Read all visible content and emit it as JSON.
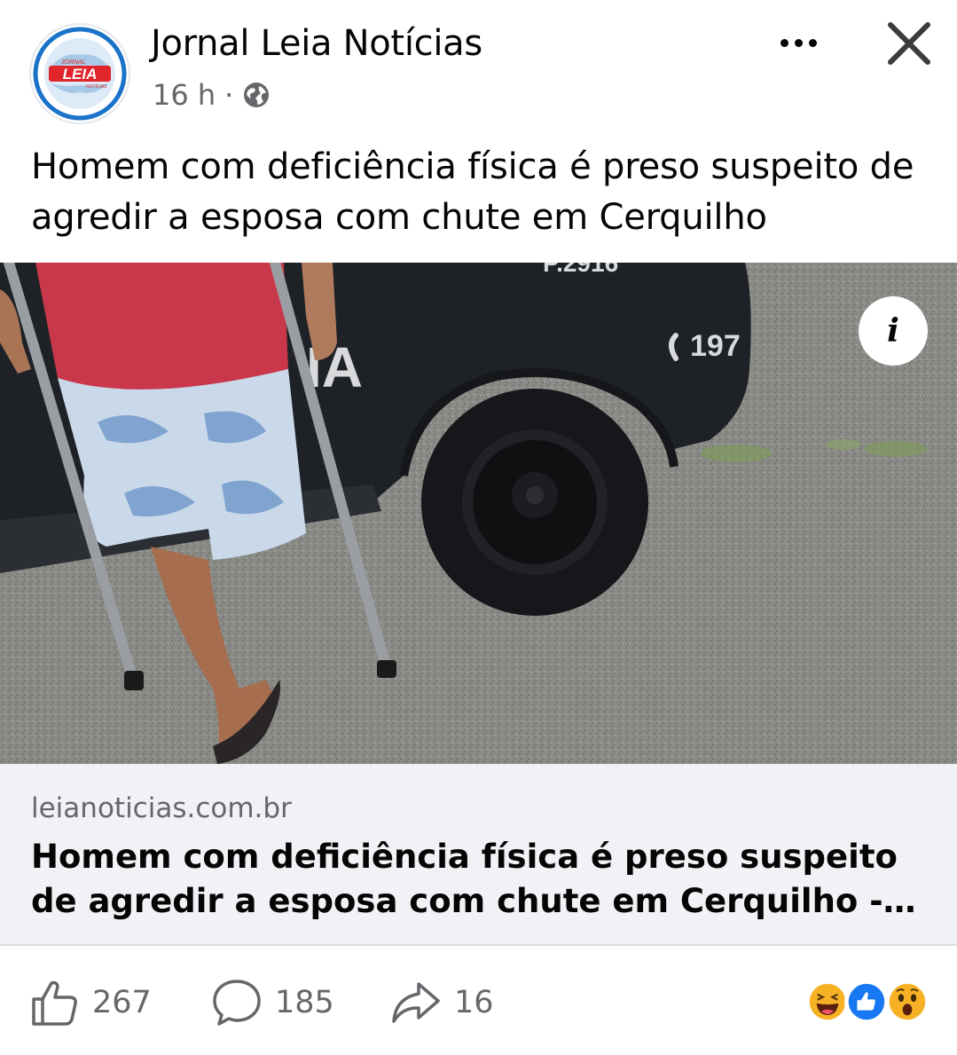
{
  "header": {
    "page_name": "Jornal Leia Notícias",
    "time": "16 h",
    "separator": "·",
    "privacy_icon": "globe-icon",
    "more_icon": "more-horizontal-icon",
    "close_icon": "close-icon",
    "logo": {
      "top_text": "JORNAL",
      "main_text": "LEIA",
      "bottom_text": "NOTÍCIAS",
      "brand_color": "#e0262b",
      "ring_color": "#1b73c9"
    }
  },
  "post": {
    "text": "Homem com deficiência física é preso suspeito de agredir a esposa com chute em Cerquilho"
  },
  "photo": {
    "car_number": "197",
    "car_plate_partial": "P.2916",
    "car_text_partial": "IA",
    "info_icon": "info-icon",
    "info_label": "i"
  },
  "link_preview": {
    "domain": "leianoticias.com.br",
    "title": "Homem com deficiência física é preso suspeito de agredir a esposa com chute em Cerquilho - Leia Notícias"
  },
  "actions": {
    "like": {
      "icon": "thumbs-up-icon",
      "count": "267"
    },
    "comment": {
      "icon": "comment-bubble-icon",
      "count": "185"
    },
    "share": {
      "icon": "share-arrow-icon",
      "count": "16"
    },
    "reactions": [
      "haha-reaction-icon",
      "like-reaction-icon",
      "wow-reaction-icon"
    ]
  },
  "colors": {
    "text_primary": "#050505",
    "text_secondary": "#65676b",
    "link_bg": "#f0f2f5",
    "like_blue": "#1877f2",
    "reaction_yellow": "#f7b125"
  }
}
